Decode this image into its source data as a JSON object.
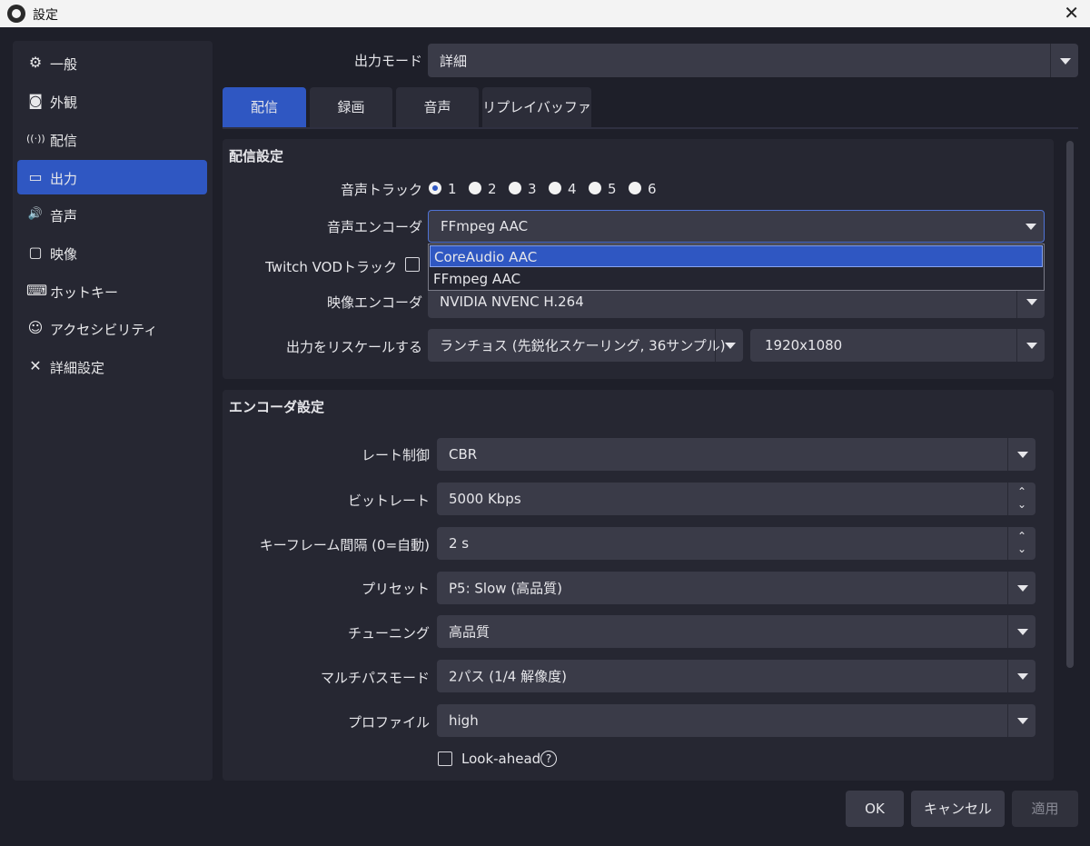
{
  "window": {
    "title": "設定",
    "close_glyph": "✕"
  },
  "sidebar": {
    "items": [
      {
        "icon": "gear-icon",
        "glyph": "⚙",
        "label": "一般"
      },
      {
        "icon": "appearance-icon",
        "glyph": "◙",
        "label": "外観"
      },
      {
        "icon": "antenna-icon",
        "glyph": "((·))",
        "label": "配信"
      },
      {
        "icon": "output-icon",
        "glyph": "▭",
        "label": "出力"
      },
      {
        "icon": "speaker-icon",
        "glyph": "🔊",
        "label": "音声"
      },
      {
        "icon": "monitor-icon",
        "glyph": "▢",
        "label": "映像"
      },
      {
        "icon": "keyboard-icon",
        "glyph": "⌨",
        "label": "ホットキー"
      },
      {
        "icon": "accessibility-icon",
        "glyph": "☺",
        "label": "アクセシビリティ"
      },
      {
        "icon": "tools-icon",
        "glyph": "✕",
        "label": "詳細設定"
      }
    ],
    "active": "出力"
  },
  "output_mode": {
    "label": "出力モード",
    "value": "詳細"
  },
  "tabs": [
    {
      "label": "配信",
      "active": true
    },
    {
      "label": "録画",
      "active": false
    },
    {
      "label": "音声",
      "active": false
    },
    {
      "label": "リプレイバッファ",
      "active": false
    }
  ],
  "stream_settings": {
    "title": "配信設定",
    "audio_track": {
      "label": "音声トラック",
      "options": [
        "1",
        "2",
        "3",
        "4",
        "5",
        "6"
      ],
      "selected": "1"
    },
    "audio_encoder": {
      "label": "音声エンコーダ",
      "value": "FFmpeg AAC",
      "options": [
        "CoreAudio AAC",
        "FFmpeg AAC"
      ],
      "highlighted": "CoreAudio AAC"
    },
    "twitch_vod": {
      "label": "Twitch VODトラック",
      "checked": false
    },
    "video_encoder": {
      "label": "映像エンコーダ",
      "value": "NVIDIA NVENC H.264"
    },
    "rescale": {
      "label": "出力をリスケールする",
      "filter": "ランチョス (先鋭化スケーリング, 36サンプル)",
      "resolution": "1920x1080"
    }
  },
  "encoder_settings": {
    "title": "エンコーダ設定",
    "rate_control": {
      "label": "レート制御",
      "value": "CBR"
    },
    "bitrate": {
      "label": "ビットレート",
      "value": "5000 Kbps"
    },
    "keyframe": {
      "label": "キーフレーム間隔 (0=自動)",
      "value": "2 s"
    },
    "preset": {
      "label": "プリセット",
      "value": "P5: Slow (高品質)"
    },
    "tuning": {
      "label": "チューニング",
      "value": "高品質"
    },
    "multipass": {
      "label": "マルチパスモード",
      "value": "2パス (1/4 解像度)"
    },
    "profile": {
      "label": "プロファイル",
      "value": "high"
    },
    "lookahead": {
      "label": "Look-ahead",
      "checked": false,
      "help_glyph": "?"
    }
  },
  "buttons": {
    "ok": "OK",
    "cancel": "キャンセル",
    "apply": "適用"
  },
  "spin_glyphs": {
    "up": "⌃",
    "down": "⌄"
  },
  "colors": {
    "accent": "#2f57c2",
    "background": "#1e1f29",
    "panel": "#262732",
    "control": "#3a3b48"
  }
}
